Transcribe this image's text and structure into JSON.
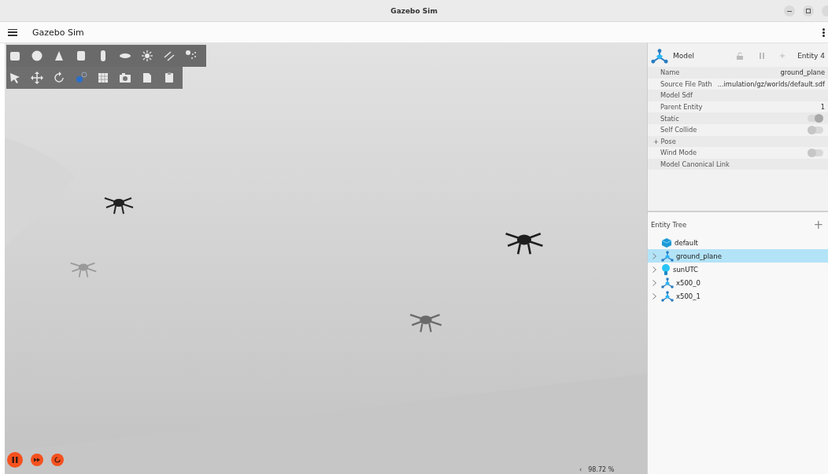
{
  "window": {
    "title": "Gazebo Sim"
  },
  "app_bar": {
    "title": "Gazebo Sim"
  },
  "viewport": {
    "zoom_arrow": "‹",
    "zoom_reading": "98.72 %"
  },
  "inspector": {
    "title": "Model",
    "entity": "Entity 4",
    "rows": [
      {
        "kind": "text",
        "label": "Name",
        "value": "ground_plane"
      },
      {
        "kind": "text",
        "label": "Source File Path",
        "value": "...imulation/gz/worlds/default.sdf"
      },
      {
        "kind": "text",
        "label": "Model Sdf"
      },
      {
        "kind": "text",
        "label": "Parent Entity",
        "value": "1"
      },
      {
        "kind": "toggle",
        "label": "Static",
        "on": true
      },
      {
        "kind": "toggle",
        "label": "Self Collide",
        "on": false
      },
      {
        "kind": "group",
        "label": "Pose",
        "expander": "+"
      },
      {
        "kind": "toggle",
        "label": "Wind Mode",
        "on": false
      },
      {
        "kind": "text",
        "label": "Model Canonical Link"
      }
    ]
  },
  "entity_tree": {
    "title": "Entity Tree",
    "add": "+",
    "items": [
      {
        "name": "default",
        "kind": "world",
        "expandable": false,
        "selected": false
      },
      {
        "name": "ground_plane",
        "kind": "model",
        "expandable": true,
        "selected": true
      },
      {
        "name": "sunUTC",
        "kind": "light",
        "expandable": true,
        "selected": false
      },
      {
        "name": "x500_0",
        "kind": "model",
        "expandable": true,
        "selected": false
      },
      {
        "name": "x500_1",
        "kind": "model",
        "expandable": true,
        "selected": false
      }
    ]
  }
}
